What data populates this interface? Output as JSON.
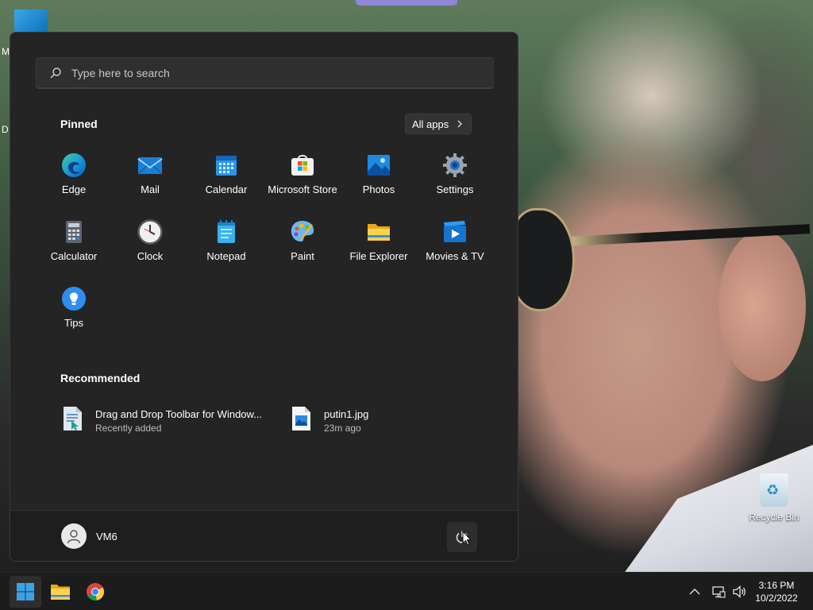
{
  "desktop": {
    "left_fragments": [
      "M",
      "D"
    ],
    "recycle_bin_label": "Recycle Bin"
  },
  "start_menu": {
    "search": {
      "placeholder": "Type here to search",
      "value": ""
    },
    "pinned": {
      "title": "Pinned",
      "all_apps_label": "All apps",
      "apps": [
        {
          "label": "Edge",
          "icon": "edge-icon"
        },
        {
          "label": "Mail",
          "icon": "mail-icon"
        },
        {
          "label": "Calendar",
          "icon": "calendar-icon"
        },
        {
          "label": "Microsoft Store",
          "icon": "store-icon"
        },
        {
          "label": "Photos",
          "icon": "photos-icon"
        },
        {
          "label": "Settings",
          "icon": "settings-icon"
        },
        {
          "label": "Calculator",
          "icon": "calculator-icon"
        },
        {
          "label": "Clock",
          "icon": "clock-icon"
        },
        {
          "label": "Notepad",
          "icon": "notepad-icon"
        },
        {
          "label": "Paint",
          "icon": "paint-icon"
        },
        {
          "label": "File Explorer",
          "icon": "file-explorer-icon"
        },
        {
          "label": "Movies & TV",
          "icon": "movies-tv-icon"
        },
        {
          "label": "Tips",
          "icon": "tips-icon"
        }
      ]
    },
    "recommended": {
      "title": "Recommended",
      "items": [
        {
          "title": "Drag and Drop Toolbar for Window...",
          "subtitle": "Recently added",
          "icon": "installer-icon"
        },
        {
          "title": "putin1.jpg",
          "subtitle": "23m ago",
          "icon": "image-file-icon"
        }
      ]
    },
    "user": {
      "name": "VM6"
    }
  },
  "taskbar": {
    "pinned": [
      {
        "name": "start-button",
        "icon": "windows-logo-icon"
      },
      {
        "name": "file-explorer-button",
        "icon": "folder-icon"
      },
      {
        "name": "chrome-button",
        "icon": "chrome-icon"
      }
    ],
    "clock": {
      "time": "3:16 PM",
      "date": "10/2/2022"
    }
  },
  "colors": {
    "menu_bg": "#242424",
    "taskbar_bg": "#1c1c1c",
    "accent": "#3aa3e8"
  }
}
